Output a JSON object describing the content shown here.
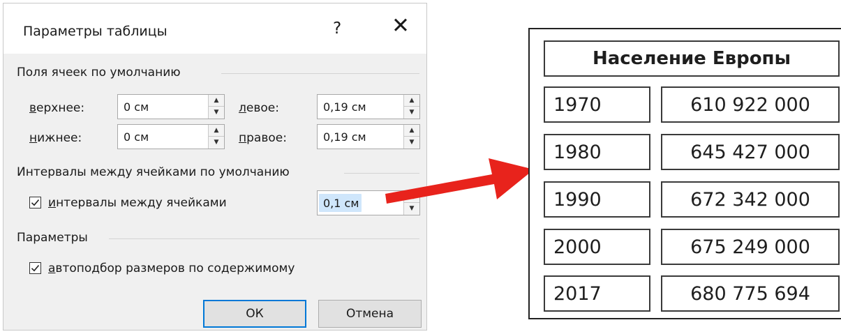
{
  "dialog": {
    "title": "Параметры таблицы",
    "help_glyph": "?",
    "close_glyph": "✕",
    "margins_group": "Поля ячеек по умолчанию",
    "fields": {
      "top": {
        "label_ul": "в",
        "label_rest": "ерхнее:",
        "value": "0 см"
      },
      "left": {
        "label_ul": "л",
        "label_rest": "евое:",
        "value": "0,19 см"
      },
      "bottom": {
        "label_ul": "н",
        "label_rest": "ижнее:",
        "value": "0 см"
      },
      "right": {
        "label_ul": "п",
        "label_rest": "равое:",
        "value": "0,19 см"
      }
    },
    "spacing_group": "Интервалы между ячейками по умолчанию",
    "spacing_check": {
      "label_ul": "и",
      "label_rest": "нтервалы между ячейками",
      "checked": true,
      "value": "0,1 см"
    },
    "options_group": "Параметры",
    "autofit_check": {
      "label_ul": "а",
      "label_rest": "втоподбор размеров по содержимому",
      "checked": true
    },
    "ok_label": "ОК",
    "cancel_label": "Отмена"
  },
  "arrow_color": "#e8231c",
  "table": {
    "header": "Население Европы",
    "rows": [
      {
        "year": "1970",
        "population": "610 922 000"
      },
      {
        "year": "1980",
        "population": "645 427 000"
      },
      {
        "year": "1990",
        "population": "672 342 000"
      },
      {
        "year": "2000",
        "population": "675 249 000"
      },
      {
        "year": "2017",
        "population": "680 775 694"
      }
    ]
  }
}
